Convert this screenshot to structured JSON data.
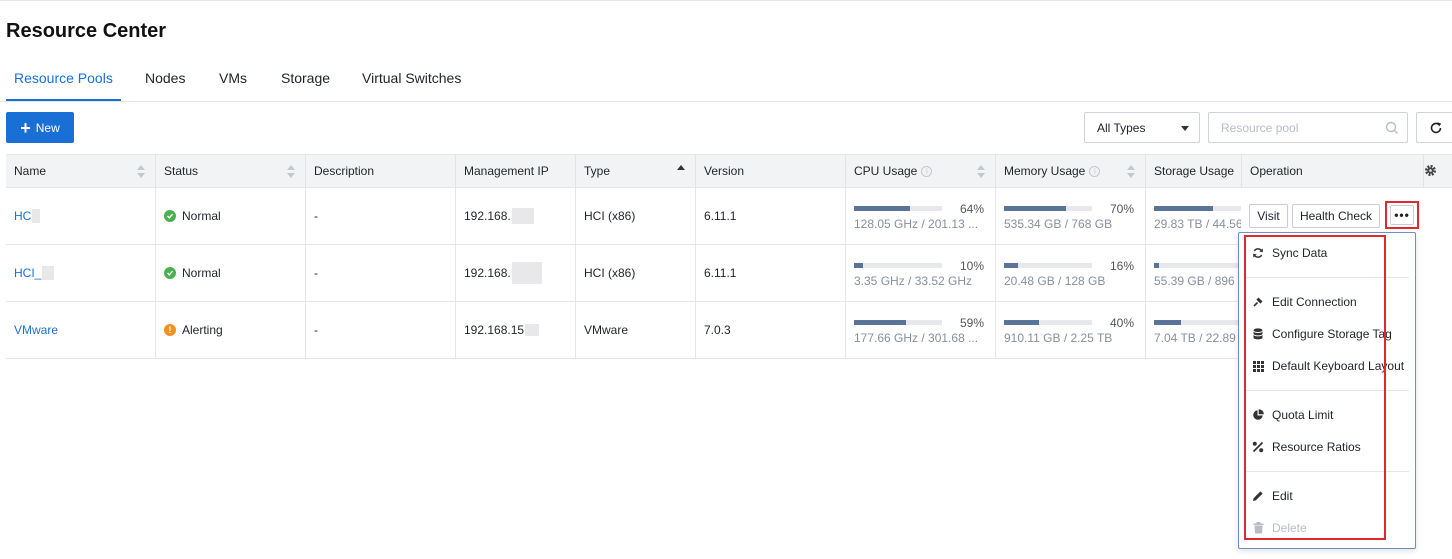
{
  "page": {
    "title": "Resource Center"
  },
  "tabs": [
    {
      "label": "Resource Pools",
      "active": true
    },
    {
      "label": "Nodes"
    },
    {
      "label": "VMs"
    },
    {
      "label": "Storage"
    },
    {
      "label": "Virtual Switches"
    }
  ],
  "toolbar": {
    "new_label": "New",
    "type_select": "All Types",
    "search_placeholder": "Resource pool"
  },
  "table": {
    "columns": [
      "Name",
      "Status",
      "Description",
      "Management IP",
      "Type",
      "Version",
      "CPU Usage",
      "Memory Usage",
      "Storage Usage",
      "Operation"
    ],
    "rows": [
      {
        "name": "HC",
        "status": "Normal",
        "description": "-",
        "ip": "192.168.",
        "type": "HCI (x86)",
        "version": "6.11.1",
        "cpu": {
          "pct": "64%",
          "value": 0.64,
          "detail": "128.05 GHz / 201.13 ..."
        },
        "mem": {
          "pct": "70%",
          "value": 0.7,
          "detail": "535.34 GB / 768 GB"
        },
        "storage": {
          "value": 0.67,
          "detail": "29.83 TB / 44.56"
        }
      },
      {
        "name": "HCI_",
        "status": "Normal",
        "description": "-",
        "ip": "192.168.",
        "type": "HCI (x86)",
        "version": "6.11.1",
        "cpu": {
          "pct": "10%",
          "value": 0.1,
          "detail": "3.35 GHz / 33.52 GHz"
        },
        "mem": {
          "pct": "16%",
          "value": 0.16,
          "detail": "20.48 GB / 128 GB"
        },
        "storage": {
          "value": 0.06,
          "detail": "55.39 GB / 896"
        }
      },
      {
        "name": "VMware",
        "status": "Alerting",
        "description": "-",
        "ip": "192.168.15",
        "type": "VMware",
        "version": "7.0.3",
        "cpu": {
          "pct": "59%",
          "value": 0.59,
          "detail": "177.66 GHz / 301.68 ..."
        },
        "mem": {
          "pct": "40%",
          "value": 0.4,
          "detail": "910.11 GB / 2.25 TB"
        },
        "storage": {
          "value": 0.31,
          "detail": "7.04 TB / 22.89"
        }
      }
    ],
    "operation": {
      "visit_label": "Visit",
      "health_label": "Health Check",
      "more_label": "•••"
    }
  },
  "colors": {
    "accent": "#1a6fd6",
    "ok": "#4caf50",
    "warn": "#f29020",
    "highlight": "#e0282e"
  },
  "menu": {
    "items": [
      {
        "label": "Sync Data",
        "icon": "sync-icon"
      },
      {
        "label": "Edit Connection",
        "icon": "plug-icon"
      },
      {
        "label": "Configure Storage Tag",
        "icon": "database-icon"
      },
      {
        "label": "Default Keyboard Layout",
        "icon": "grid-icon"
      },
      {
        "label": "Quota Limit",
        "icon": "pie-chart-icon"
      },
      {
        "label": "Resource Ratios",
        "icon": "percent-icon"
      },
      {
        "label": "Edit",
        "icon": "pencil-icon"
      },
      {
        "label": "Delete",
        "icon": "trash-icon",
        "disabled": true
      }
    ]
  }
}
